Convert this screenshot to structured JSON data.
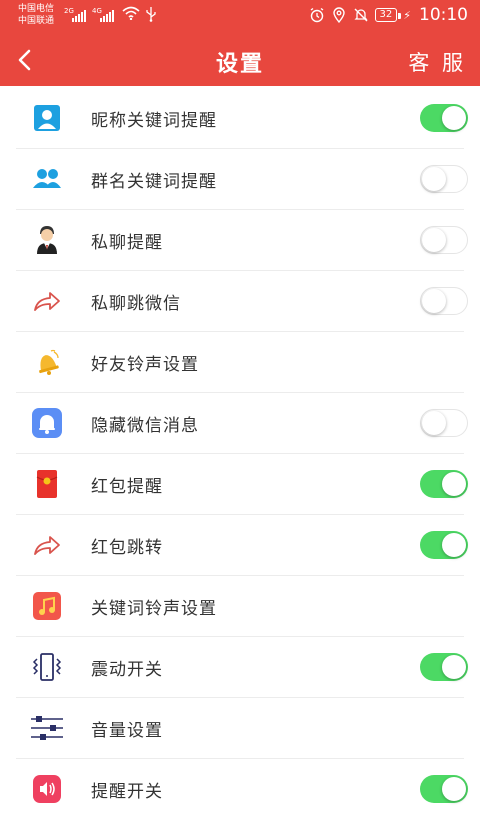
{
  "status_bar": {
    "carrier_1": "中国电信",
    "carrier_2": "中国联通",
    "net_1": "2G",
    "net_2": "4G",
    "battery": "32",
    "time": "10:10"
  },
  "header": {
    "title": "设置",
    "service_label": "客 服"
  },
  "settings": [
    {
      "label": "昵称关键词提醒",
      "icon": "user-icon",
      "has_toggle": true,
      "on": true
    },
    {
      "label": "群名关键词提醒",
      "icon": "group-icon",
      "has_toggle": true,
      "on": false
    },
    {
      "label": "私聊提醒",
      "icon": "person-icon",
      "has_toggle": true,
      "on": false
    },
    {
      "label": "私聊跳微信",
      "icon": "share-arrow-icon",
      "has_toggle": true,
      "on": false
    },
    {
      "label": "好友铃声设置",
      "icon": "bell-icon",
      "has_toggle": false
    },
    {
      "label": "隐藏微信消息",
      "icon": "notification-bell-icon",
      "has_toggle": true,
      "on": false
    },
    {
      "label": "红包提醒",
      "icon": "red-envelope-icon",
      "has_toggle": true,
      "on": true
    },
    {
      "label": "红包跳转",
      "icon": "share-arrow-icon",
      "has_toggle": true,
      "on": true
    },
    {
      "label": "关键词铃声设置",
      "icon": "music-note-icon",
      "has_toggle": false
    },
    {
      "label": "震动开关",
      "icon": "vibrate-icon",
      "has_toggle": true,
      "on": true
    },
    {
      "label": "音量设置",
      "icon": "sliders-icon",
      "has_toggle": false
    },
    {
      "label": "提醒开关",
      "icon": "speaker-icon",
      "has_toggle": true,
      "on": true
    }
  ],
  "colors": {
    "header_bg": "#e8473e",
    "toggle_on": "#4cd964"
  }
}
